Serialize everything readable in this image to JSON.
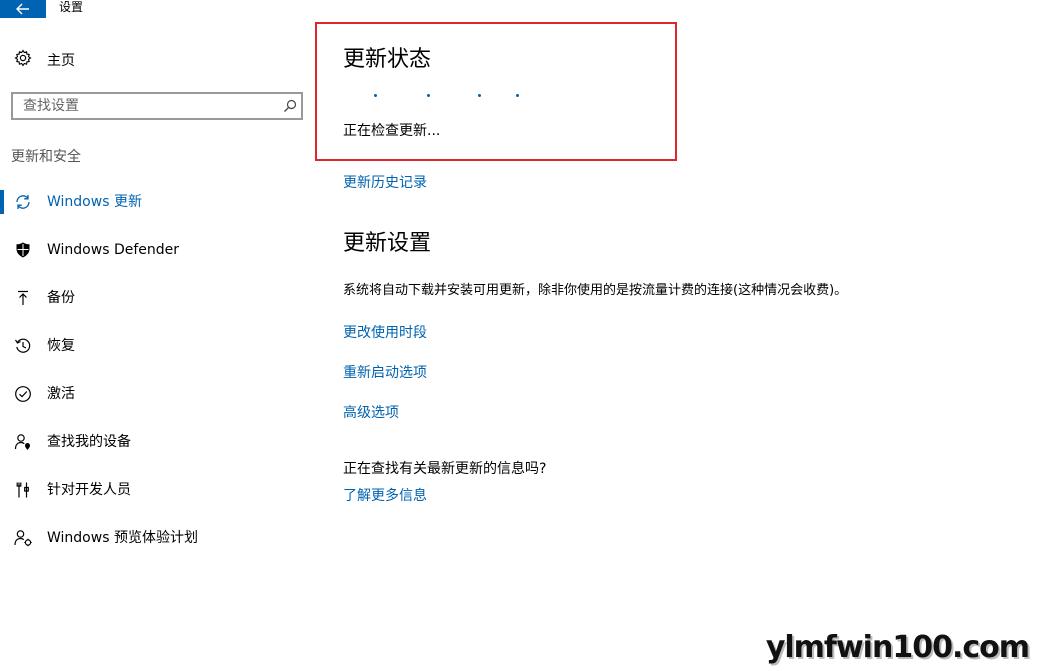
{
  "window": {
    "title": "设置"
  },
  "sidebar": {
    "home_label": "主页",
    "search_placeholder": "查找设置",
    "section_title": "更新和安全",
    "items": [
      {
        "label": "Windows 更新",
        "icon": "refresh-icon",
        "active": true
      },
      {
        "label": "Windows Defender",
        "icon": "shield-icon"
      },
      {
        "label": "备份",
        "icon": "upload-arrow-icon"
      },
      {
        "label": "恢复",
        "icon": "history-icon"
      },
      {
        "label": "激活",
        "icon": "check-circle-icon"
      },
      {
        "label": "查找我的设备",
        "icon": "person-location-icon"
      },
      {
        "label": "针对开发人员",
        "icon": "tools-icon"
      },
      {
        "label": "Windows 预览体验计划",
        "icon": "insider-person-icon"
      }
    ]
  },
  "main": {
    "update_status_title": "更新状态",
    "status_text": "正在检查更新...",
    "history_link": "更新历史记录",
    "settings_title": "更新设置",
    "settings_desc": "系统将自动下载并安装可用更新，除非你使用的是按流量计费的连接(这种情况会收费)。",
    "links": {
      "active_hours": "更改使用时段",
      "restart_options": "重新启动选项",
      "advanced_options": "高级选项"
    },
    "info_question": "正在查找有关最新更新的信息吗?",
    "learn_more": "了解更多信息"
  },
  "colors": {
    "accent": "#0063b1",
    "highlight_border": "#e0262c"
  },
  "watermark": "ylmfwin100.com"
}
